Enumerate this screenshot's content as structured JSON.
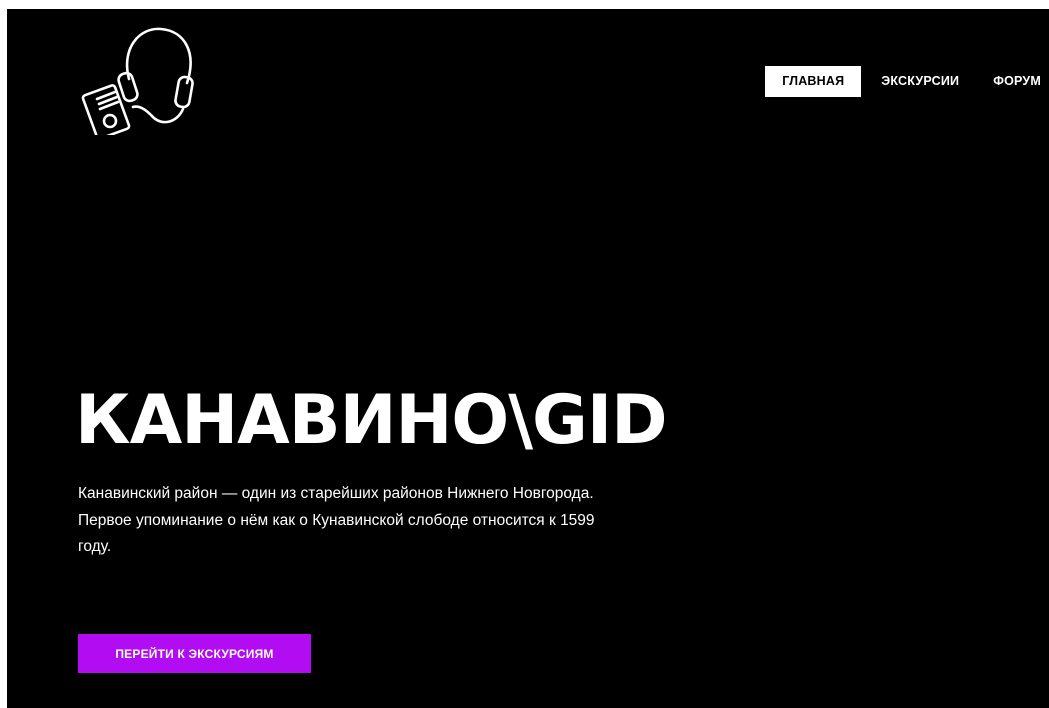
{
  "header": {
    "logo_icon": "headphones-audio-player-icon",
    "nav": [
      {
        "label": "ГЛАВНАЯ",
        "active": true
      },
      {
        "label": "ЭКСКУРСИИ",
        "active": false
      },
      {
        "label": "ФОРУМ",
        "active": false
      }
    ]
  },
  "hero": {
    "title": "КАНАВИНО\\GID",
    "description": "Канавинский район — один из старейших районов Нижнего Новгорода. Первое упоминание о нём как о Кунавинской слободе относится к 1599 году.",
    "cta_label": "ПЕРЕЙТИ К ЭКСКУРСИЯМ"
  },
  "colors": {
    "background": "#000000",
    "text": "#ffffff",
    "accent": "#b10cf2",
    "nav_active_bg": "#ffffff"
  }
}
